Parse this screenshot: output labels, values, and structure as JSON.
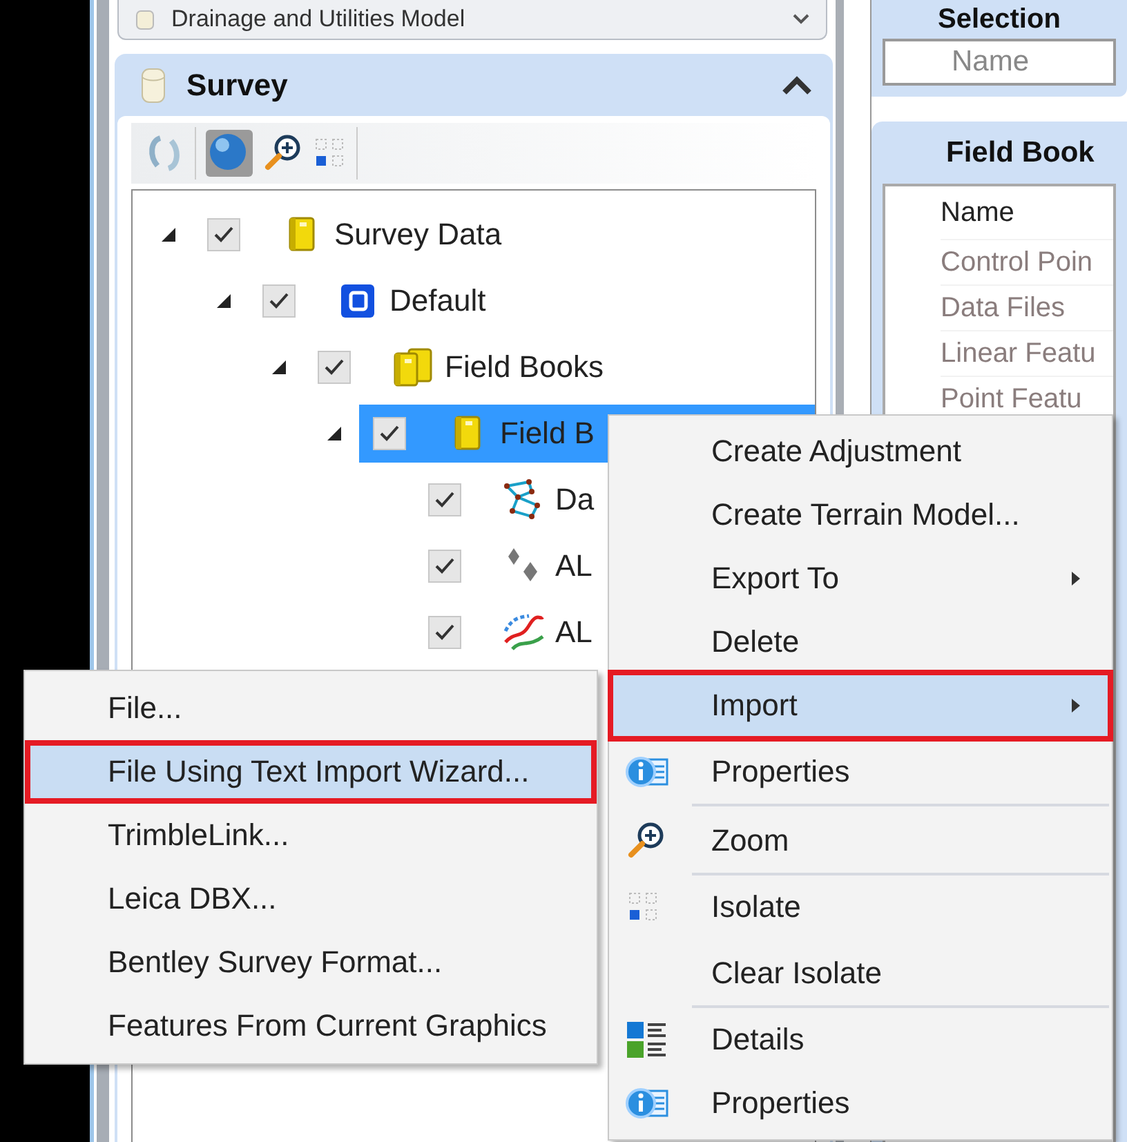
{
  "top_panel": {
    "title": "Drainage and Utilities Model"
  },
  "survey_panel": {
    "title": "Survey",
    "expanded": true,
    "tree": [
      {
        "label": "Survey Data",
        "kind": "book",
        "checked": true,
        "expanded": true,
        "selected": false,
        "children": [
          {
            "label": "Default",
            "kind": "project",
            "checked": true,
            "expanded": true,
            "selected": false,
            "children": [
              {
                "label": "Field Books",
                "kind": "books",
                "checked": true,
                "expanded": true,
                "selected": false,
                "children": [
                  {
                    "label": "Field B",
                    "kind": "book",
                    "checked": true,
                    "expanded": true,
                    "selected": true,
                    "children": [
                      {
                        "label": "Da",
                        "kind": "network",
                        "checked": true,
                        "selected": false
                      },
                      {
                        "label": "AL",
                        "kind": "points",
                        "checked": true,
                        "selected": false
                      },
                      {
                        "label": "AL",
                        "kind": "lines",
                        "checked": true,
                        "selected": false
                      }
                    ]
                  }
                ]
              }
            ]
          }
        ]
      }
    ]
  },
  "selection_panel": {
    "title": "Selection",
    "field": {
      "placeholder": "Name"
    }
  },
  "field_book_panel": {
    "title": "Field Book",
    "header": "Name",
    "rows": [
      "Control Poin",
      "Data Files",
      "Linear Featu",
      "Point Featu"
    ]
  },
  "context_menu": [
    {
      "label": "Create Adjustment",
      "kind": "plain",
      "submenu": false,
      "highlighted": false,
      "separator": false
    },
    {
      "label": "Create Terrain Model...",
      "kind": "plain",
      "submenu": false,
      "highlighted": false,
      "separator": false
    },
    {
      "label": "Export To",
      "kind": "plain",
      "submenu": true,
      "highlighted": false,
      "separator": false
    },
    {
      "label": "Delete",
      "kind": "plain",
      "submenu": false,
      "highlighted": false,
      "separator": false
    },
    {
      "label": "Import",
      "kind": "plain",
      "submenu": true,
      "highlighted": true,
      "separator": false
    },
    {
      "label": "Properties",
      "kind": "info",
      "submenu": false,
      "highlighted": false,
      "separator": true
    },
    {
      "label": "Zoom",
      "kind": "zoom",
      "submenu": false,
      "highlighted": false,
      "separator": true
    },
    {
      "label": "Isolate",
      "kind": "isolate",
      "submenu": false,
      "highlighted": false,
      "separator": false
    },
    {
      "label": "Clear Isolate",
      "kind": "plain",
      "submenu": false,
      "highlighted": false,
      "separator": true
    },
    {
      "label": "Details",
      "kind": "details",
      "submenu": false,
      "highlighted": false,
      "separator": false
    },
    {
      "label": "Properties",
      "kind": "info",
      "submenu": false,
      "highlighted": false,
      "separator": false
    }
  ],
  "import_submenu": [
    {
      "label": "File...",
      "highlighted": false
    },
    {
      "label": "File Using Text Import Wizard...",
      "highlighted": true
    },
    {
      "label": "TrimbleLink...",
      "highlighted": false
    },
    {
      "label": "Leica DBX...",
      "highlighted": false
    },
    {
      "label": "Bentley Survey Format...",
      "highlighted": false
    },
    {
      "label": "Features From Current Graphics",
      "highlighted": false
    }
  ]
}
